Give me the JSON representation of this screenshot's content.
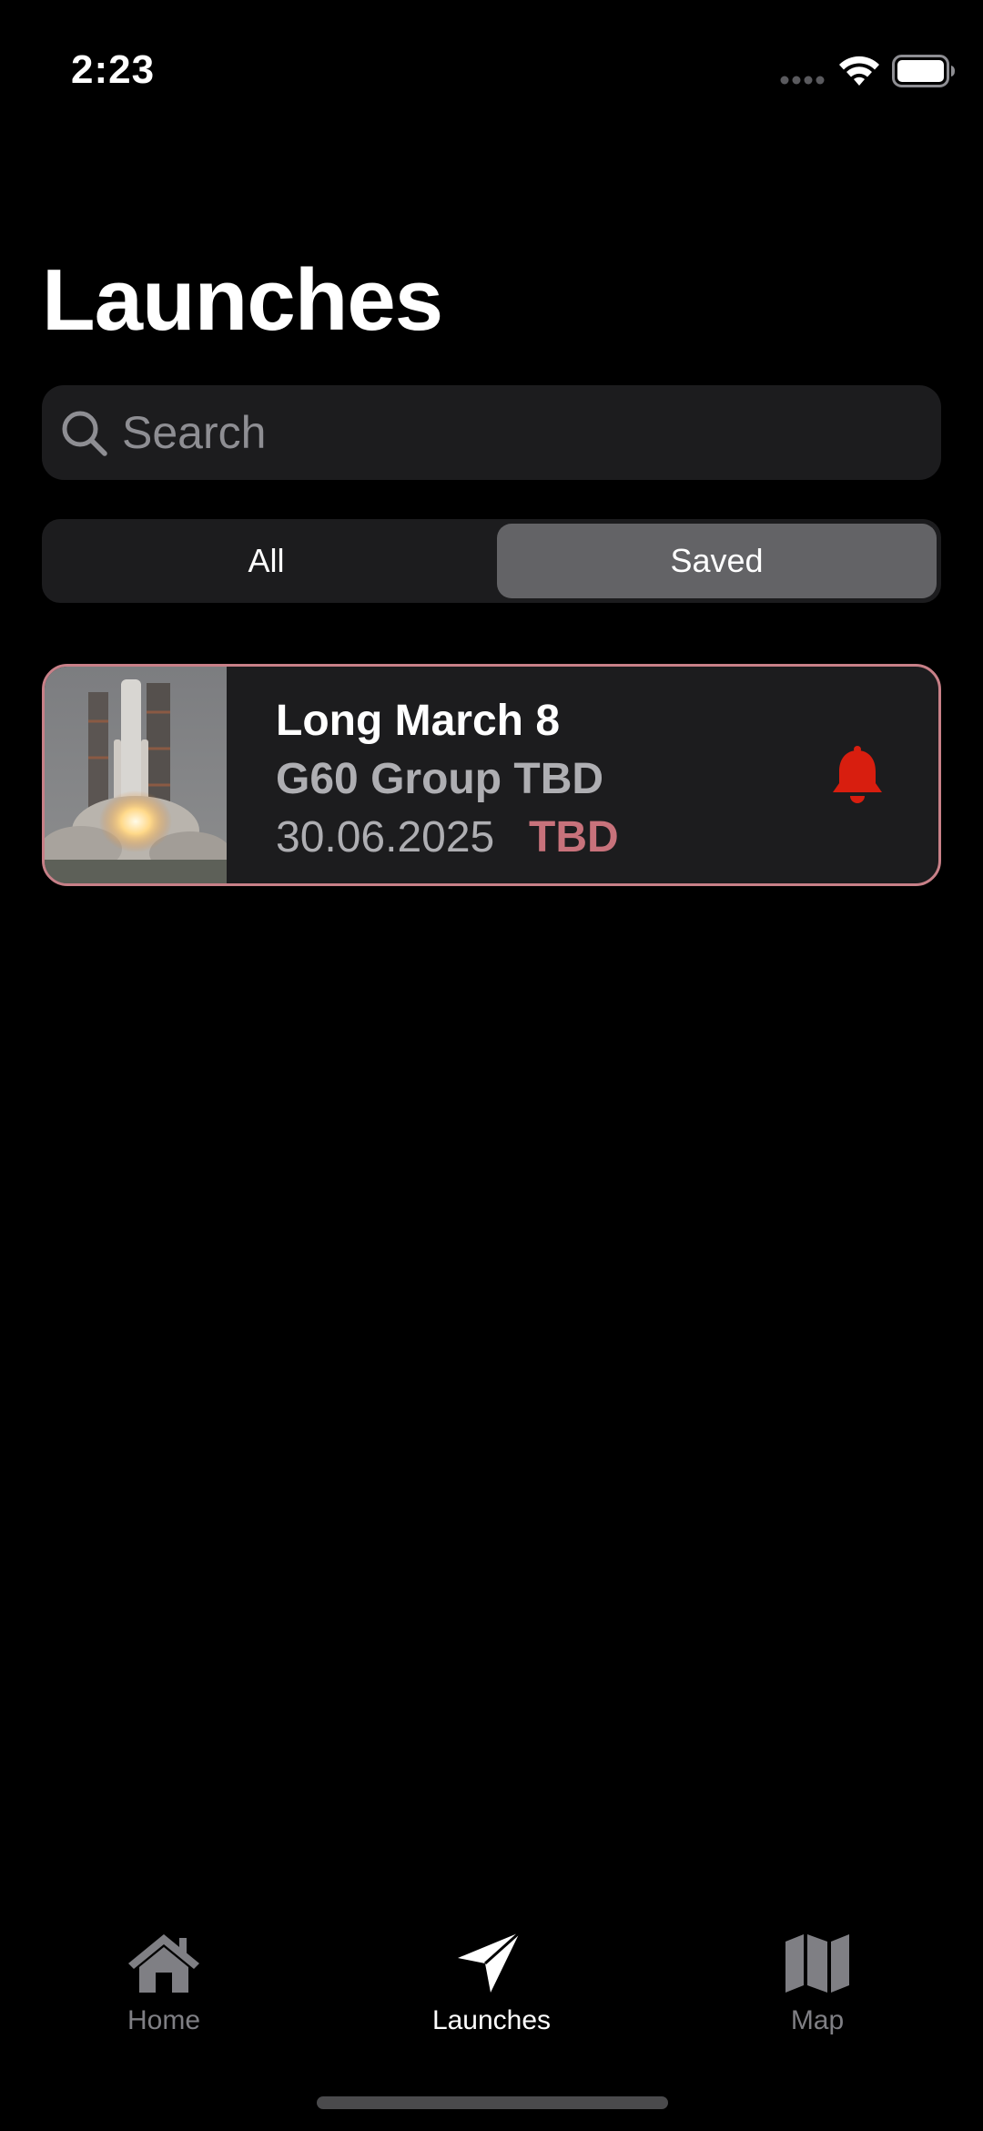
{
  "status_bar": {
    "time": "2:23"
  },
  "page": {
    "title": "Launches"
  },
  "search": {
    "placeholder": "Search",
    "value": ""
  },
  "filter": {
    "options": [
      "All",
      "Saved"
    ],
    "selected": "Saved"
  },
  "launches": [
    {
      "name": "Long March 8",
      "mission": "G60 Group TBD",
      "date": "30.06.2025",
      "status": "TBD",
      "notification_icon": "bell-icon",
      "saved": true
    }
  ],
  "tab_bar": {
    "items": [
      {
        "label": "Home",
        "icon": "house-icon",
        "active": false
      },
      {
        "label": "Launches",
        "icon": "paper-plane-icon",
        "active": true
      },
      {
        "label": "Map",
        "icon": "map-icon",
        "active": false
      }
    ]
  },
  "colors": {
    "background": "#000000",
    "card": "#1c1c1e",
    "card_border": "#c88088",
    "status_tbd": "#c8727b",
    "bell": "#d81e0f",
    "tab_active": "#ffffff",
    "tab_inactive": "#7f7f84"
  }
}
